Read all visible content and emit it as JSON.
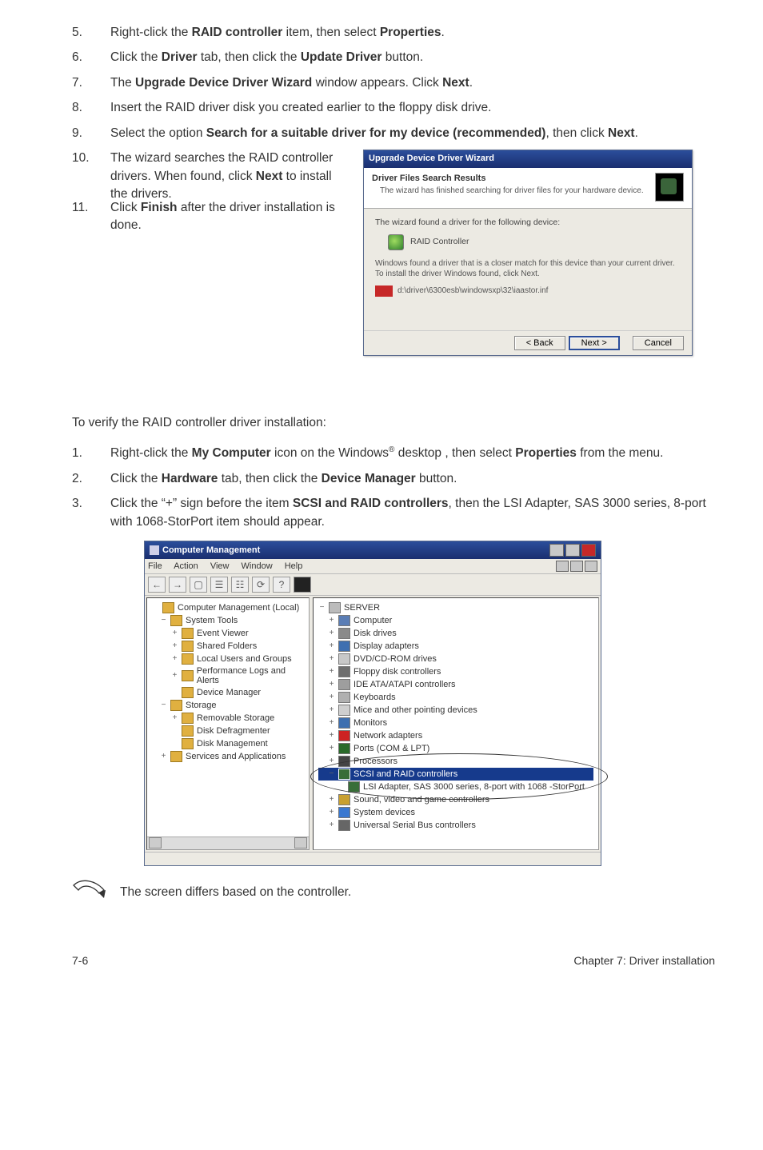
{
  "steps_a": {
    "s5": {
      "n": "5.",
      "pre": "Right-click the ",
      "b1": "RAID controller",
      "mid": " item, then select ",
      "b2": "Properties",
      "post": "."
    },
    "s6": {
      "n": "6.",
      "pre": "Click the ",
      "b1": "Driver",
      "mid": " tab, then click the ",
      "b2": "Update Driver",
      "post": " button."
    },
    "s7": {
      "n": "7.",
      "pre": "The ",
      "b1": "Upgrade Device Driver Wizard",
      "mid": " window appears. Click ",
      "b2": "Next",
      "post": "."
    },
    "s8": {
      "n": "8.",
      "text": "Insert the RAID driver disk you created earlier to the floppy disk drive."
    },
    "s9": {
      "n": "9.",
      "pre": "Select the option ",
      "b1": "Search for a suitable driver for my device (recommended)",
      "mid": ", then click ",
      "b2": "Next",
      "post": "."
    },
    "s10": {
      "n": "10.",
      "pre": "The wizard searches the RAID controller drivers. When found, click ",
      "b1": "Next",
      "post": " to install the drivers."
    },
    "s11": {
      "n": "11.",
      "pre": "Click ",
      "b1": "Finish",
      "post": " after the driver installation is done."
    }
  },
  "wizard": {
    "title": "Upgrade Device Driver Wizard",
    "header1": "Driver Files Search Results",
    "header2": "The wizard has finished searching for driver files for your hardware device.",
    "body_line1": "The wizard found a driver for the following device:",
    "device_label": "RAID Controller",
    "body_para": "Windows found a driver that is a closer match for this device than your current driver. To install the driver Windows found, click Next.",
    "path": "d:\\driver\\6300esb\\windowsxp\\32\\iaastor.inf",
    "btn_back": "< Back",
    "btn_next": "Next >",
    "btn_cancel": "Cancel"
  },
  "verify_intro": "To verify the RAID controller driver installation:",
  "steps_b": {
    "s1": {
      "n": "1.",
      "pre": "Right-click the ",
      "b1": "My Computer",
      "mid1": " icon on the Windows",
      "sup": "®",
      "mid2": " desktop , then select ",
      "b2": "Properties",
      "post": " from the menu."
    },
    "s2": {
      "n": "2.",
      "pre": "Click the ",
      "b1": "Hardware",
      "mid": " tab, then click the ",
      "b2": "Device Manager",
      "post": " button."
    },
    "s3": {
      "n": "3.",
      "pre": "Click the “+” sign before the item ",
      "b1": "SCSI and RAID controllers",
      "post": ", then the LSI Adapter, SAS 3000 series, 8-port with 1068-StorPort item should appear."
    }
  },
  "cm": {
    "title": "Computer Management",
    "menus": {
      "file": "File",
      "action": "Action",
      "view": "View",
      "window": "Window",
      "help": "Help"
    },
    "tree": {
      "root": "Computer Management (Local)",
      "n1": "System Tools",
      "n1a": "Event Viewer",
      "n1b": "Shared Folders",
      "n1c": "Local Users and Groups",
      "n1d": "Performance Logs and Alerts",
      "n1e": "Device Manager",
      "n2": "Storage",
      "n2a": "Removable Storage",
      "n2b": "Disk Defragmenter",
      "n2c": "Disk Management",
      "n3": "Services and Applications"
    },
    "right": {
      "root": "SERVER",
      "r1": "Computer",
      "r2": "Disk drives",
      "r3": "Display adapters",
      "r4": "DVD/CD-ROM drives",
      "r5": "Floppy disk controllers",
      "r6": "IDE ATA/ATAPI controllers",
      "r7": "Keyboards",
      "r8": "Mice and other pointing devices",
      "r9": "Monitors",
      "r10": "Network adapters",
      "r11": "Ports (COM & LPT)",
      "r12": "Processors",
      "r13": "SCSI and RAID controllers",
      "r13a": "LSI Adapter, SAS 3000 series, 8-port with 1068 -StorPort",
      "r14": "Sound, video and game controllers",
      "r15": "System devices",
      "r16": "Universal Serial Bus controllers"
    }
  },
  "note": "The screen differs based on the controller.",
  "footer_left": "7-6",
  "footer_right": "Chapter 7: Driver installation"
}
